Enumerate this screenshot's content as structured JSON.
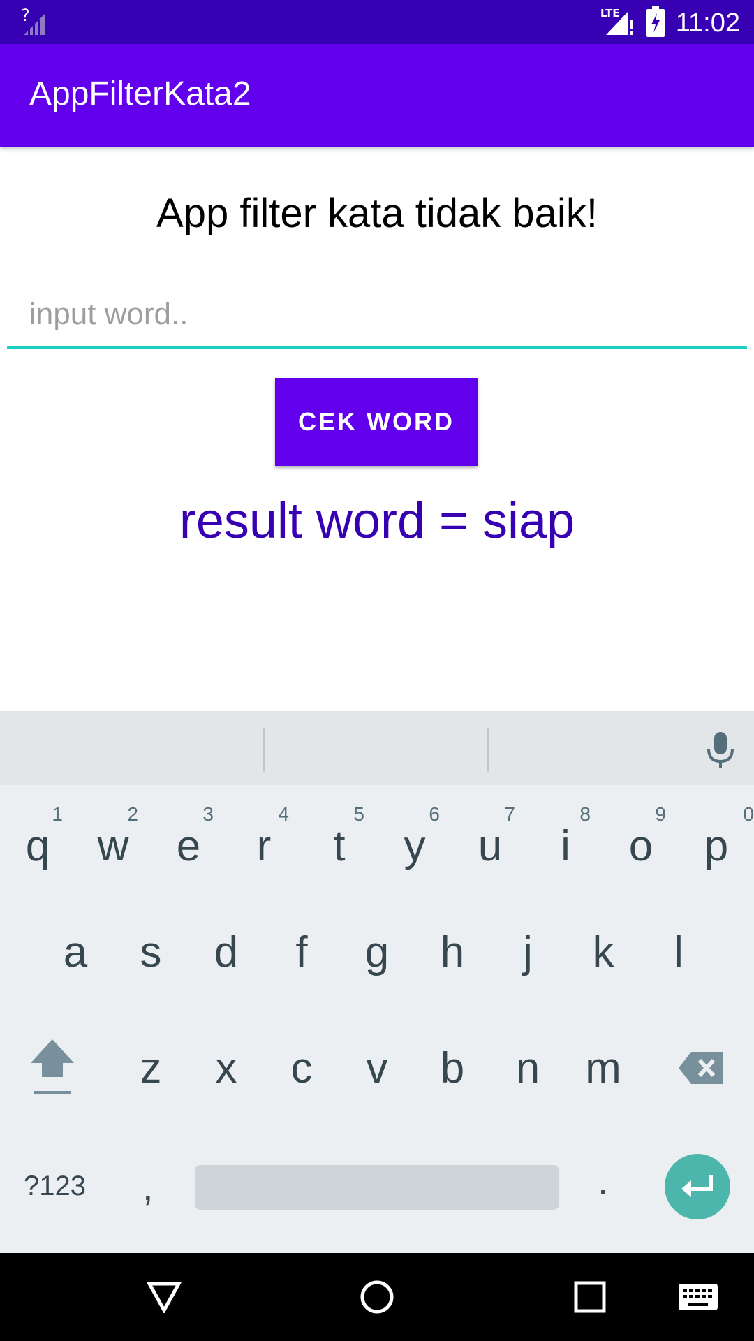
{
  "status_bar": {
    "time": "11:02",
    "network": "LTE",
    "background": "#3700B3"
  },
  "app_bar": {
    "title": "AppFilterKata2",
    "background": "#6200EE"
  },
  "main": {
    "heading": "App filter kata tidak baik!",
    "input": {
      "placeholder": "input word..",
      "value": "",
      "underline_color": "#1ccfc5"
    },
    "cek_button": {
      "label": "CEK WORD"
    },
    "result_text": "result word = siap",
    "result_color": "#3700B3"
  },
  "keyboard": {
    "row1": [
      {
        "key": "q",
        "hint": "1"
      },
      {
        "key": "w",
        "hint": "2"
      },
      {
        "key": "e",
        "hint": "3"
      },
      {
        "key": "r",
        "hint": "4"
      },
      {
        "key": "t",
        "hint": "5"
      },
      {
        "key": "y",
        "hint": "6"
      },
      {
        "key": "u",
        "hint": "7"
      },
      {
        "key": "i",
        "hint": "8"
      },
      {
        "key": "o",
        "hint": "9"
      },
      {
        "key": "p",
        "hint": "0"
      }
    ],
    "row2": [
      "a",
      "s",
      "d",
      "f",
      "g",
      "h",
      "j",
      "k",
      "l"
    ],
    "row3": [
      "z",
      "x",
      "c",
      "v",
      "b",
      "n",
      "m"
    ],
    "symbols_label": "?123",
    "comma": ",",
    "period": ".",
    "icons": [
      "mic-icon",
      "shift-icon",
      "backspace-icon",
      "enter-icon"
    ],
    "enter_color": "#4db6ac"
  },
  "nav_bar": {
    "icons": [
      "back-icon",
      "home-icon",
      "recents-icon",
      "keyboard-switch-icon"
    ]
  }
}
